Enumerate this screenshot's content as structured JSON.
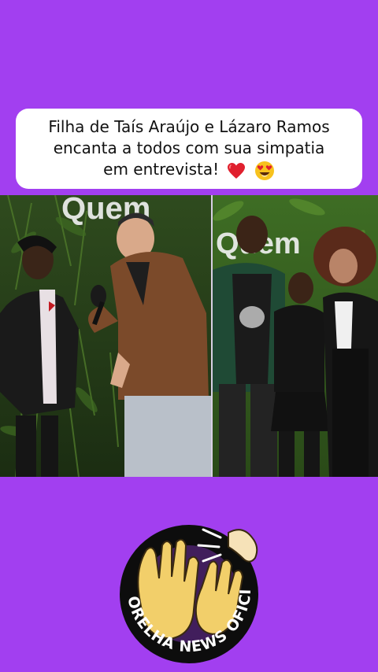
{
  "caption": {
    "line1": "Filha de Taís Araújo e Lázaro Ramos",
    "line2": "encanta a todos com sua simpatia",
    "line3": "em entrevista!"
  },
  "photos": {
    "left_sign": "Quem",
    "right_sign": "Quem"
  },
  "logo": {
    "text": "NA ORELHA NEWS OFICIAL"
  },
  "colors": {
    "background": "#a23ff0",
    "caption_bg": "#ffffff",
    "logo_ring": "#0d0d0d",
    "logo_hands": "#f2cf6a"
  },
  "icons": [
    "heart-emoji-icon",
    "heart-eyes-emoji-icon",
    "hands-listening-logo-icon"
  ]
}
